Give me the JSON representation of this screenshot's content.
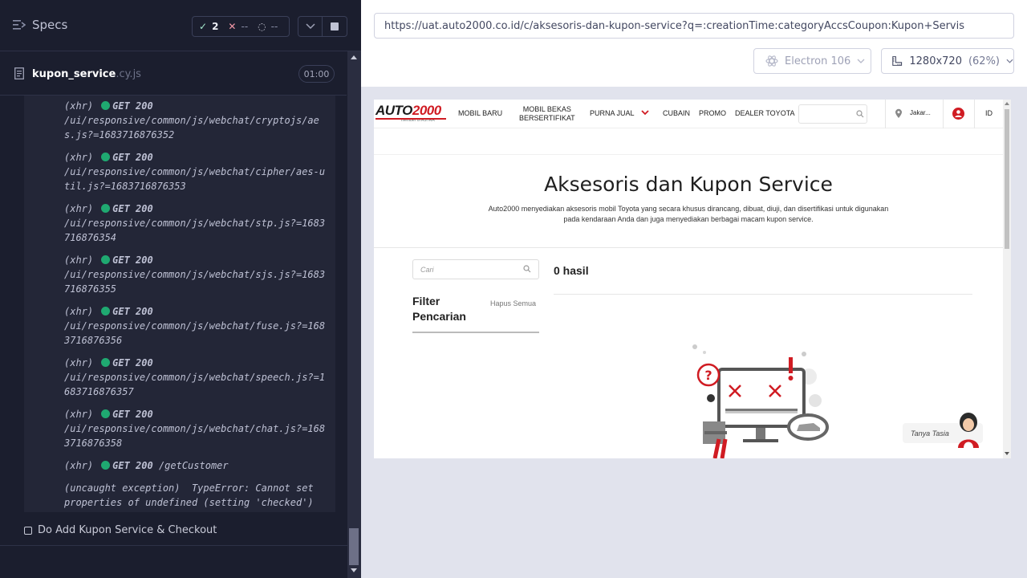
{
  "runner": {
    "specs_label": "Specs",
    "stats": {
      "passed": "2",
      "failed": "--",
      "pending": "--"
    },
    "spec_file": {
      "name": "kupon_service",
      "ext": ".cy.js",
      "duration": "01:00"
    },
    "log": [
      {
        "tag": "(xhr)",
        "method": "GET 200",
        "path": "/ui/responsive/common/js/webchat/cryptojs/aes.js?=1683716876352"
      },
      {
        "tag": "(xhr)",
        "method": "GET 200",
        "path": "/ui/responsive/common/js/webchat/cipher/aes-util.js?=1683716876353"
      },
      {
        "tag": "(xhr)",
        "method": "GET 200",
        "path": "/ui/responsive/common/js/webchat/stp.js?=1683716876354"
      },
      {
        "tag": "(xhr)",
        "method": "GET 200",
        "path": "/ui/responsive/common/js/webchat/sjs.js?=1683716876355"
      },
      {
        "tag": "(xhr)",
        "method": "GET 200",
        "path": "/ui/responsive/common/js/webchat/fuse.js?=1683716876356"
      },
      {
        "tag": "(xhr)",
        "method": "GET 200",
        "path": "/ui/responsive/common/js/webchat/speech.js?=1683716876357"
      },
      {
        "tag": "(xhr)",
        "method": "GET 200",
        "path": "/ui/responsive/common/js/webchat/chat.js?=1683716876358"
      },
      {
        "tag": "(xhr)",
        "method": "GET 200",
        "path": "/getCustomer"
      }
    ],
    "exception": {
      "label": "(uncaught exception)",
      "message": "TypeError: Cannot set properties of undefined (setting 'checked')"
    },
    "test_title": "Do Add Kupon Service & Checkout"
  },
  "aut": {
    "url": "https://uat.auto2000.co.id/c/aksesoris-dan-kupon-service?q=:creationTime:categoryAccsCoupon:Kupon+Servis",
    "browser": "Electron 106",
    "viewport": "1280x720",
    "scale": "(62%)"
  },
  "site": {
    "logo_main": "AUTO",
    "logo_num": "2000",
    "logo_sub": "member of ASTRA",
    "nav": {
      "mobil_baru": "MOBIL BARU",
      "mobil_bekas_1": "MOBIL BEKAS",
      "mobil_bekas_2": "BERSERTIFIKAT",
      "purna_jual": "PURNA JUAL",
      "cubain": "CUBAIN",
      "promo": "PROMO",
      "dealer": "DEALER TOYOTA",
      "location": "Jakar...",
      "lang": "ID"
    },
    "hero_title": "Aksesoris dan Kupon Service",
    "hero_desc": "Auto2000 menyediakan aksesoris mobil Toyota yang secara khusus dirancang, dibuat, diuji, dan disertifikasi untuk digunakan pada kendaraan Anda dan juga menyediakan berbagai macam kupon service.",
    "search_placeholder": "Cari",
    "filter_title_1": "Filter",
    "filter_title_2": "Pencarian",
    "clear_all": "Hapus Semua",
    "results": "0 hasil",
    "chat_label": "Tanya Tasia"
  },
  "colors": {
    "brand_red": "#d01c23",
    "pass_green": "#1fa971",
    "runner_bg": "#1b1e2e"
  }
}
